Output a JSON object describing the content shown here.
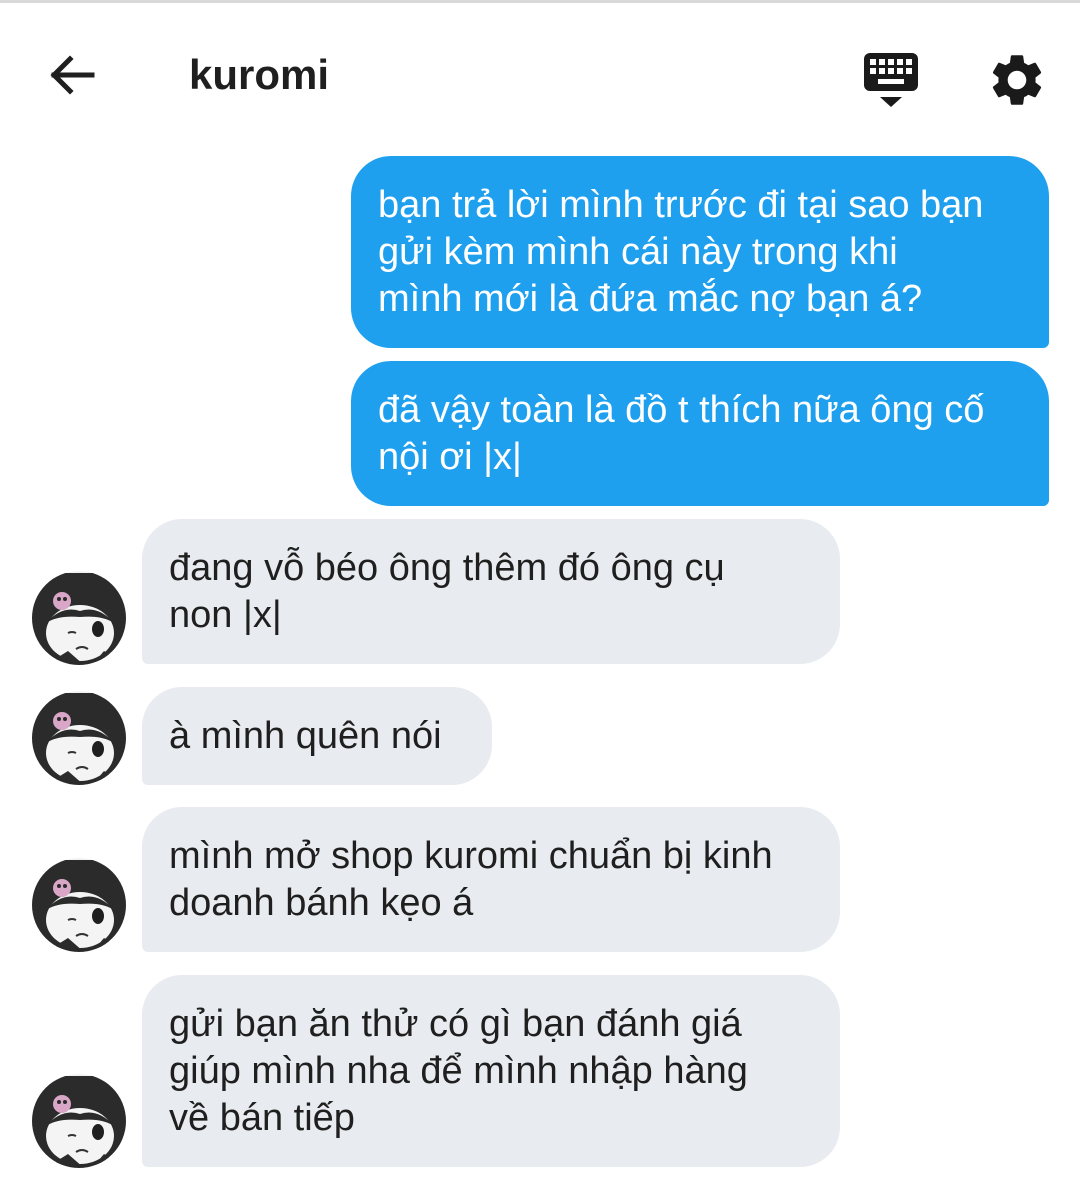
{
  "header": {
    "title": "kuromi",
    "back_icon": "arrow-left-icon",
    "keyboard_icon": "keyboard-hide-icon",
    "settings_icon": "gear-icon"
  },
  "colors": {
    "outgoing_bubble": "#1fa0ef",
    "incoming_bubble": "#e8ebef",
    "text_dark": "#1f1f1f"
  },
  "messages": [
    {
      "direction": "outgoing",
      "text": "bạn trả lời mình trước đi tại sao bạn\ngửi kèm mình cái này trong khi\nmình mới là đứa mắc nợ bạn á?"
    },
    {
      "direction": "outgoing",
      "text": "đã vậy toàn là đồ t thích nữa ông cố\nnội ơi |x|"
    },
    {
      "direction": "incoming",
      "text": "đang vỗ béo ông thêm đó ông cụ\nnon |x|"
    },
    {
      "direction": "incoming",
      "text": "à mình quên nói"
    },
    {
      "direction": "incoming",
      "text": "mình mở shop kuromi chuẩn bị kinh\ndoanh bánh kẹo á"
    },
    {
      "direction": "incoming",
      "text": "gửi bạn ăn thử có gì bạn đánh giá\ngiúp mình nha để mình nhập hàng\nvề bán tiếp"
    }
  ]
}
